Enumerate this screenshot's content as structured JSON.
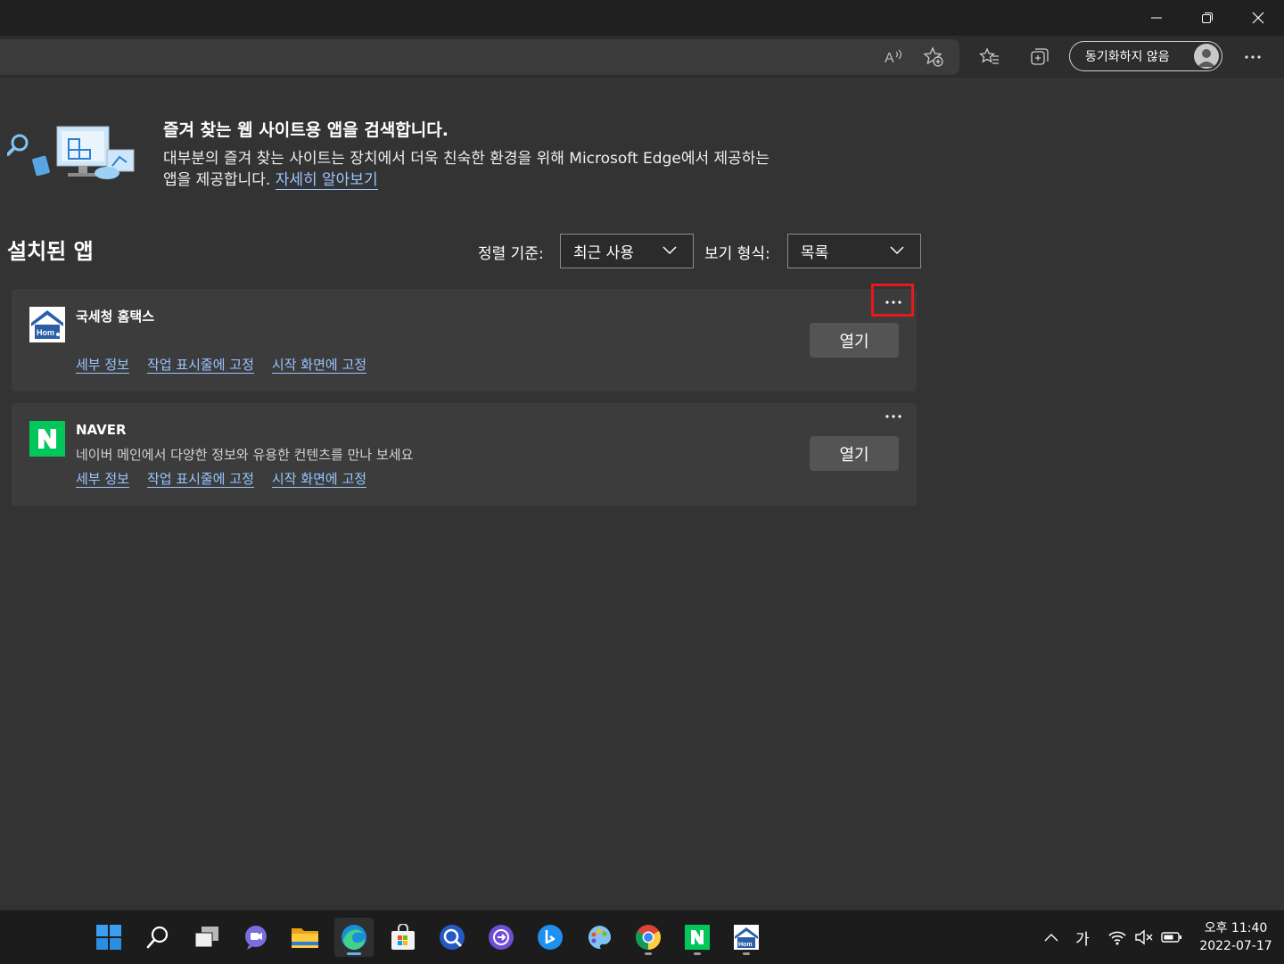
{
  "toolbar": {
    "sync_label": "동기화하지 않음"
  },
  "hero": {
    "title": "즐겨 찾는 웹 사이트용 앱을 검색합니다.",
    "description_line1": "대부분의 즐겨 찾는 사이트는 장치에서 더욱 친숙한 환경을 위해 Microsoft Edge에서 제공하는",
    "description_line2": "앱을 제공합니다.",
    "learn_more": "자세히 알아보기"
  },
  "installed": {
    "title": "설치된 앱",
    "sort_label": "정렬 기준:",
    "sort_value": "최근 사용",
    "view_label": "보기 형식:",
    "view_value": "목록"
  },
  "apps": [
    {
      "name": "국세청 홈택스",
      "description": "",
      "details": "세부 정보",
      "pin_taskbar": "작업 표시줄에 고정",
      "pin_start": "시작 화면에 고정",
      "open": "열기"
    },
    {
      "name": "NAVER",
      "description": "네이버 메인에서 다양한 정보와 유용한 컨텐츠를 만나 보세요",
      "details": "세부 정보",
      "pin_taskbar": "작업 표시줄에 고정",
      "pin_start": "시작 화면에 고정",
      "open": "열기"
    }
  ],
  "taskbar": {
    "ime": "가",
    "time": "오후 11:40",
    "date": "2022-07-17"
  },
  "colors": {
    "accent_link": "#99c5ff",
    "highlight_box": "#e51a1a",
    "naver_green": "#03c75a",
    "hometax_blue": "#2a5fa8"
  }
}
